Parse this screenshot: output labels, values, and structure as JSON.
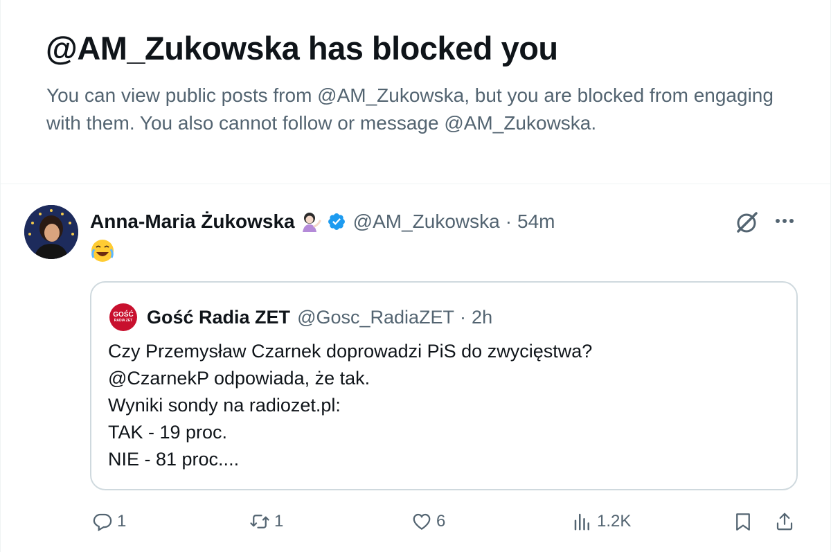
{
  "block_notice": {
    "title": "@AM_Zukowska has blocked you",
    "description": "You can view public posts from @AM_Zukowska, but you are blocked from engaging with them. You also cannot follow or message @AM_Zukowska."
  },
  "post": {
    "author_name": "Anna-Maria Żukowska",
    "author_handle": "@AM_Zukowska",
    "separator": "·",
    "timestamp": "54m",
    "body_emoji": "😂",
    "icons": [
      "person-tipping-hand-emoji",
      "verified-badge-icon",
      "grok-icon",
      "more-icon"
    ],
    "quote": {
      "avatar_line1": "GOŚĆ",
      "avatar_line2": "RADIA ZET",
      "name": "Gość Radia ZET",
      "handle": "@Gosc_RadiaZET",
      "separator": "·",
      "timestamp": "2h",
      "lines": [
        "Czy Przemysław Czarnek doprowadzi PiS do zwycięstwa?",
        "@CzarnekP odpowiada, że tak.",
        "Wyniki sondy na radiozet.pl:",
        "TAK - 19 proc.",
        "NIE - 81 proc...."
      ]
    },
    "actions": {
      "reply_count": "1",
      "repost_count": "1",
      "like_count": "6",
      "views_count": "1.2K"
    }
  },
  "colors": {
    "text_primary": "#0f1419",
    "text_secondary": "#536471",
    "border": "#cfd9de",
    "verified": "#1d9bf0"
  }
}
